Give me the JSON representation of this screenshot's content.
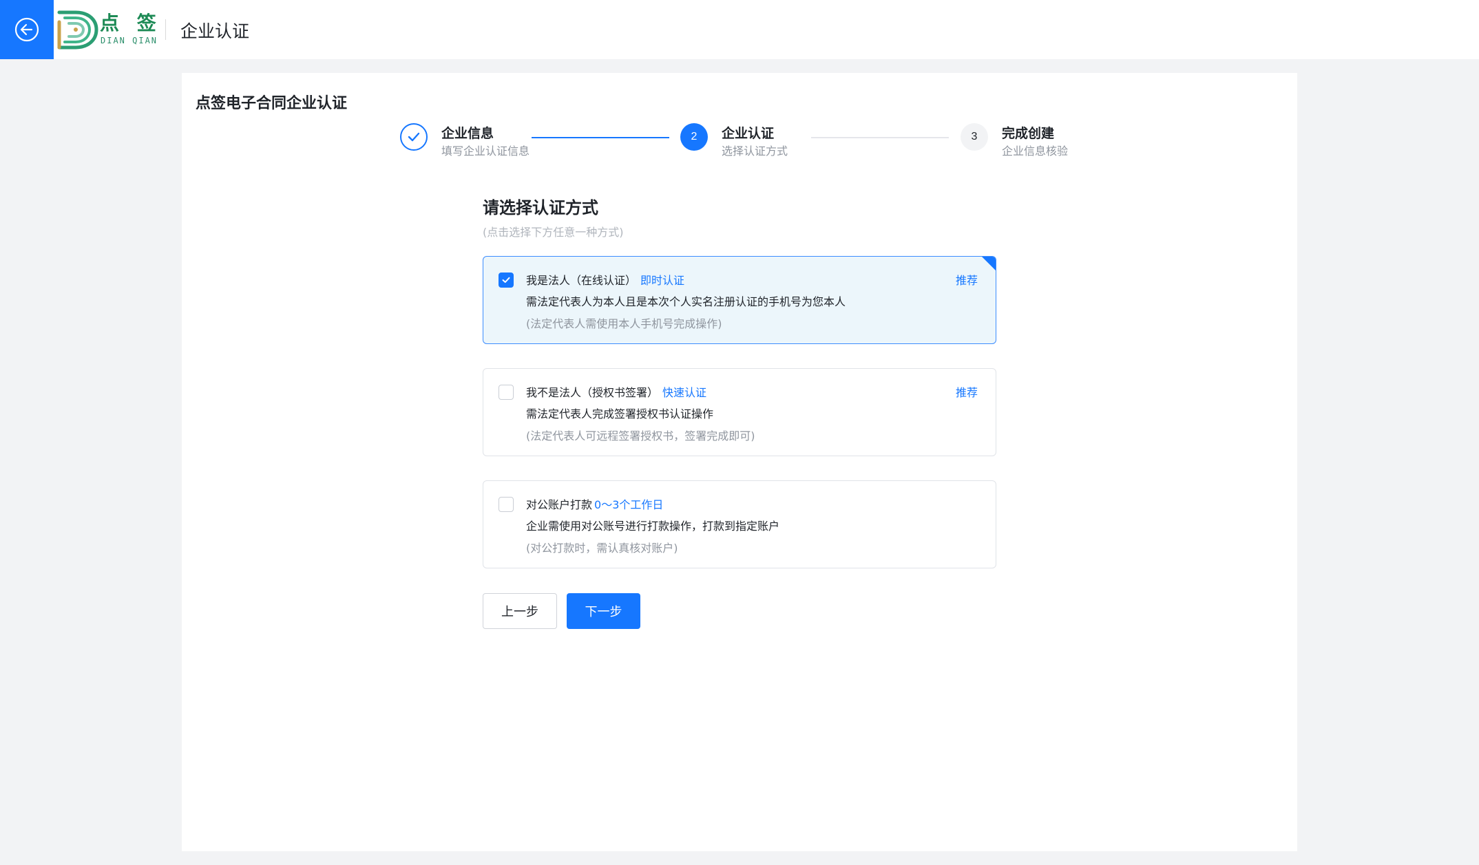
{
  "header": {
    "logo": {
      "name": "点 签",
      "sub": "DIAN QIAN"
    },
    "title": "企业认证"
  },
  "card": {
    "title": "点签电子合同企业认证"
  },
  "steps": [
    {
      "title": "企业信息",
      "desc": "填写企业认证信息",
      "status": "done",
      "number": "1"
    },
    {
      "title": "企业认证",
      "desc": "选择认证方式",
      "status": "active",
      "number": "2"
    },
    {
      "title": "完成创建",
      "desc": "企业信息核验",
      "status": "wait",
      "number": "3"
    }
  ],
  "section": {
    "title": "请选择认证方式",
    "hint": "(点击选择下方任意一种方式)"
  },
  "options": [
    {
      "label": "我是法人（在线认证）",
      "tag": "即时认证",
      "desc": "需法定代表人为本人且是本次个人实名注册认证的手机号为您本人",
      "note": "(法定代表人需使用本人手机号完成操作)",
      "recommend": "推荐",
      "selected": true
    },
    {
      "label": "我不是法人（授权书签署）",
      "tag": "快速认证",
      "desc": "需法定代表人完成签署授权书认证操作",
      "note": "(法定代表人可远程签署授权书，签署完成即可)",
      "recommend": "推荐",
      "selected": false
    },
    {
      "label": "对公账户打款",
      "tag": "0～3个工作日",
      "desc": "企业需使用对公账号进行打款操作，打款到指定账户",
      "note": "(对公打款时，需认真核对账户)",
      "recommend": "",
      "selected": false
    }
  ],
  "buttons": {
    "prev": "上一步",
    "next": "下一步"
  },
  "colors": {
    "primary": "#1677ff",
    "selected_bg": "#ecf6fb",
    "brand_green": "#1d8a55"
  }
}
